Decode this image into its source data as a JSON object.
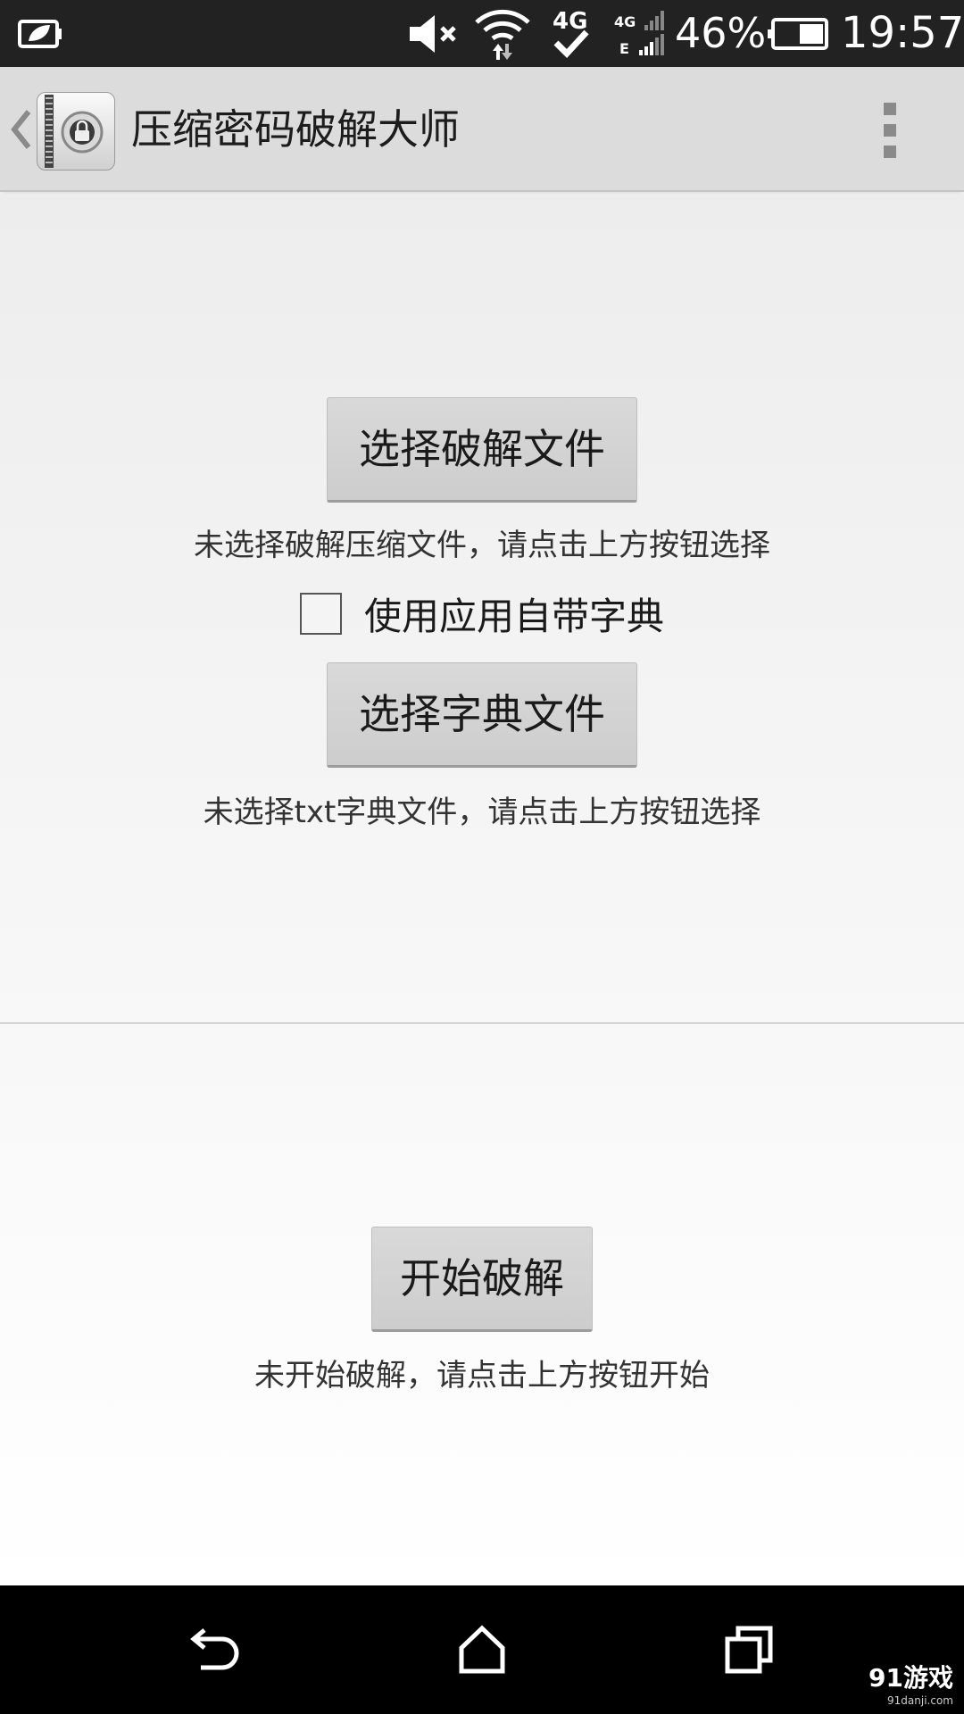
{
  "status_bar": {
    "battery_percent": "46%",
    "time": "19:57",
    "icons": [
      "battery-saver-icon",
      "mute-icon",
      "wifi-icon",
      "4g-icon",
      "signal-icon",
      "battery-icon"
    ],
    "network_label": "4G",
    "network_label_small": "4G",
    "network_label_e": "E",
    "battery_level": 0.46
  },
  "action_bar": {
    "title": "压缩密码破解大师"
  },
  "main": {
    "select_file_button": "选择破解文件",
    "select_file_hint": "未选择破解压缩文件，请点击上方按钮选择",
    "use_builtin_dict_label": "使用应用自带字典",
    "use_builtin_dict_checked": false,
    "select_dict_button": "选择字典文件",
    "select_dict_hint": "未选择txt字典文件，请点击上方按钮选择",
    "start_button": "开始破解",
    "start_hint": "未开始破解，请点击上方按钮开始"
  },
  "watermark": {
    "logo": "91游戏",
    "url": "91danji.com"
  }
}
